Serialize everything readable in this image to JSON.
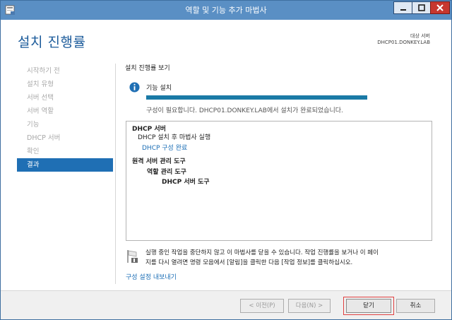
{
  "window": {
    "title": "역할 및 기능 추가 마법사"
  },
  "header": {
    "title": "설치 진행률",
    "target_label": "대상 서버",
    "target_value": "DHCP01.DONKEY.LAB"
  },
  "nav": {
    "items": [
      {
        "label": "시작하기 전",
        "active": false
      },
      {
        "label": "설치 유형",
        "active": false
      },
      {
        "label": "서버 선택",
        "active": false
      },
      {
        "label": "서버 역할",
        "active": false
      },
      {
        "label": "기능",
        "active": false
      },
      {
        "label": "DHCP 서버",
        "active": false
      },
      {
        "label": "확인",
        "active": false
      },
      {
        "label": "결과",
        "active": true
      }
    ]
  },
  "content": {
    "section_title": "설치 진행률 보기",
    "status_label": "기능 설치",
    "progress_percent": 100,
    "progress_message": "구성이 필요합니다. DHCP01.DONKEY.LAB에서 설치가 완료되었습니다.",
    "details": [
      "DHCP 서버",
      "DHCP 설치 후 마법사 실행",
      "DHCP 구성 완료",
      "원격 서버 관리 도구",
      "역할 관리 도구",
      "DHCP 서버 도구"
    ],
    "note_line1": "실행 중인 작업을 중단하지 않고 이 마법사를 닫을 수 있습니다. 작업 진행률을 보거나 이 페이",
    "note_line2": "지를 다시 열려면 명령 모음에서 [알림]을 클릭한 다음 [작업 정보]를 클릭하십시오.",
    "export_link": "구성 설정 내보내기"
  },
  "footer": {
    "prev_label": "< 이전(P)",
    "next_label": "다음(N) >",
    "close_label": "닫기",
    "cancel_label": "취소"
  },
  "colors": {
    "titlebar": "#5a8fc4",
    "accent": "#1f6fb4",
    "progress": "#1a7aa6",
    "link": "#1a6db5"
  },
  "icons": {
    "app": "server-manager-icon",
    "info": "info-icon",
    "note": "flag-icon"
  }
}
